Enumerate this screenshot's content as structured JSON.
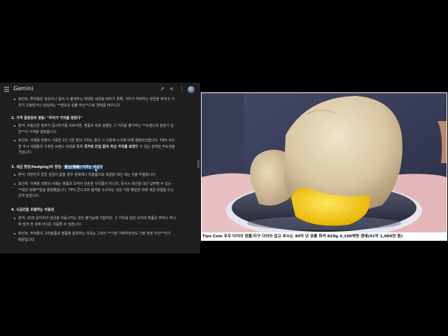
{
  "app": {
    "title": "Gemini"
  },
  "header_icons": [
    "share-external-icon",
    "share-icon",
    "more-vert-icon"
  ],
  "chat": {
    "line1": "포인트: 투자용은 상속이나 증여 시 평생하는 박대한 세금을 피하기 위해, 가치가 하락하는 현금을 바꾸고 가",
    "line2": "치가 고정되거나 상승하는 **영속성 실물 자산**으로 형태를 바꾸니다.",
    "sec2_title": "2. 가격 결정권의 정동: \"우리가 가치를 정한다\"",
    "s2_b1_l1": "분석: 무동산은 정부가 공시지가를 미르지만, 명품과 희귀 광물은 그 가치를 평가하는 **브랜드와 판분가 집",
    "s2_b1_l2": "단**이 가격을 결정합니다.",
    "s2_b2_l1": "포인트: 이재용 회장이 기중한 2인 3천 점의 가치는 결국 그 시장에 누구에 의해 결정되었습니다. TIPS 코드",
    "s2_b2_l2_a": "럴 악시 사람들이 구축한 브랜드 파워를 통해 ",
    "s2_b2_l2_b": "국가의 간섭 없이 자산 가치를 보전",
    "s2_b2_l2_c": "할 수 있는 강력한 주도권을",
    "s2_b2_l3": "가집니다.",
    "sec3_title_a": "3. 세금 헷징(Hedging)의 정점: ",
    "sec3_title_b": "'물납(物納)'이라는 비상구",
    "s3_b1": "분석: 대한민국 일은 현금이 없을 경우 문화재나 미술품으로 세금을 대신 내는 것을 허용합니다.",
    "s3_b2_l1": "포인트: 이재용 회장의 사례는 명품과 보석이 단순한 사치품이 아니라, 유사시 세건을 대신 납부할 수 있는",
    "s3_b2_l2": "**대안 화폐**임을 증명했습니다. TIPS 콘드코와 협약을 소유하는 것은 가장 확실한 미래 세금 보험을 드는",
    "s3_b2_l3": "것과 같습니다.",
    "sec4_title": "4. 시공간을 초월하는 이동성",
    "s4_b1_l1": "분석: 10조 원어치의 현금을 이동시키는 것은 불가능에 가깝지만, 그 가치를 담은 보석과 명품은 주머니 하나",
    "s4_b1_l2": "에 담겨 전 세계 어디든 이동할 수 있습니다.",
    "s4_b2_l1": "포인트: 부자들이 고미술품과 명품에 집착하는 이유는 그것이 **가장 가벼우면서도 가장 비싼 자산**이기",
    "s4_b2_l2": "때문입니다."
  },
  "photo": {
    "caption": "Tips Coin 우주 다이아 광물/지구 다이아 업고 부수는 40억 년 공룡 화석 820g 4,100캐럿 경매(41억 1,000만 원)"
  },
  "colors": {
    "panel_bg": "#1f1f1f",
    "highlight": "#264f8c",
    "background": "#000000"
  }
}
